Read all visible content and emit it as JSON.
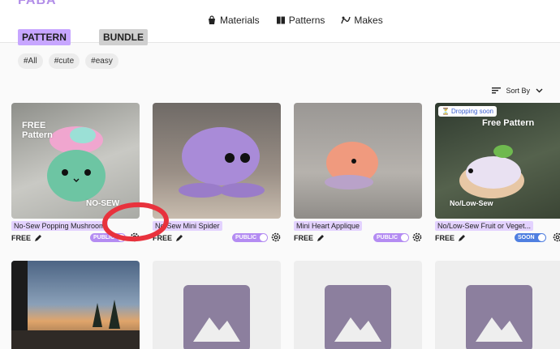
{
  "brand": {
    "text": "FABA"
  },
  "nav": [
    {
      "label": "Materials",
      "icon": "shopping-bag-icon"
    },
    {
      "label": "Patterns",
      "icon": "book-icon"
    },
    {
      "label": "Makes",
      "icon": "yarn-hook-icon"
    }
  ],
  "type_tabs": [
    {
      "label": "PATTERN",
      "selected": true
    },
    {
      "label": "BUNDLE",
      "selected": false
    }
  ],
  "tags": [
    "#All",
    "#cute",
    "#easy"
  ],
  "sort": {
    "label": "Sort By"
  },
  "cards": [
    {
      "title": "No-Sew Popping Mushroom",
      "price": "FREE",
      "status": "PUBLIC",
      "overlay_top": "FREE\nPattern",
      "overlay_bottom": "NO-SEW"
    },
    {
      "title": "No-Sew Mini Spider",
      "price": "FREE",
      "status": "PUBLIC"
    },
    {
      "title": "Mini Heart Applique",
      "price": "FREE",
      "status": "PUBLIC"
    },
    {
      "title": "No/Low-Sew Fruit or Veget...",
      "price": "FREE",
      "status": "SOON",
      "badge": "Dropping soon",
      "overlay_top": "Free Pattern",
      "overlay_bottom": "No/Low-Sew"
    }
  ],
  "colors": {
    "accent": "#c7a6ff",
    "title_pill": "#e3d2ff",
    "status_public": "#b48cf2",
    "status_soon": "#4f7fe0",
    "annotation": "#e8323d",
    "placeholder_icon": "#8c7f9e"
  }
}
